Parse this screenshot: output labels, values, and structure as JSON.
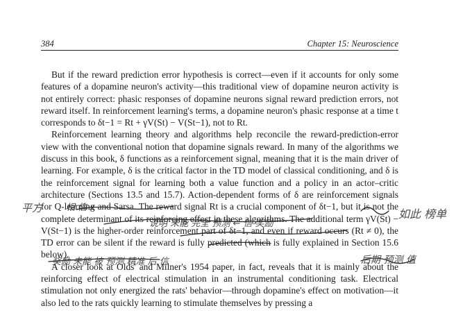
{
  "header": {
    "page_number": "384",
    "chapter_title": "Chapter 15: Neuroscience"
  },
  "paragraphs": [
    "But if the reward prediction error hypothesis is correct—even if it accounts for only some features of a dopamine neuron's activity—this traditional view of dopamine neuron activity is not entirely correct: phasic responses of dopamine neurons signal reward prediction errors, not reward itself. In reinforcement learning's terms, a dopamine neuron's phasic response at a time t corresponds to δt−1 = Rt + γV(St) − V(St−1), not to Rt.",
    "Reinforcement learning theory and algorithms help reconcile the reward-prediction-error view with the conventional notion that dopamine signals reward. In many of the algorithms we discuss in this book, δ functions as a reinforcement signal, meaning that it is the main driver of learning. For example, δ is the critical factor in the TD model of classical conditioning, and δ is the reinforcement signal for learning both a value function and a policy in an actor–critic architecture (Sections 13.5 and 15.7). Action-dependent forms of δ are reinforcement signals for Q-learning and Sarsa. The reward signal Rt is a crucial component of δt−1, but it is not the complete determinant of its reinforcing effect in these algorithms. The additional term γV(St) − V(St−1) is the higher-order reinforcement part of δt−1, and even if reward occurs (Rt ≠ 0), the TD error can be silent if the reward is fully predicted (which is fully explained in Section 15.6 below).",
    "A closer look at Olds' and Milner's 1954 paper, in fact, reveals that it is mainly about the reinforcing effect of electrical stimulation in an instrumental conditioning task. Electrical stimulation not only energized the rats' behavior—through dopamine's effect on motivation—it also led to the rats quickly learning to stimulate themselves by pressing a"
  ],
  "handwriting": {
    "left_margin": "平方",
    "line1": "相 信 ⅹ",
    "line2": "说明 未能 完全 预测 ← 信 奖励",
    "right_margin": "如此 榜单",
    "line3": "后期 预测 值",
    "line4": "奖励 未能 被 预测 精准 后 信"
  }
}
